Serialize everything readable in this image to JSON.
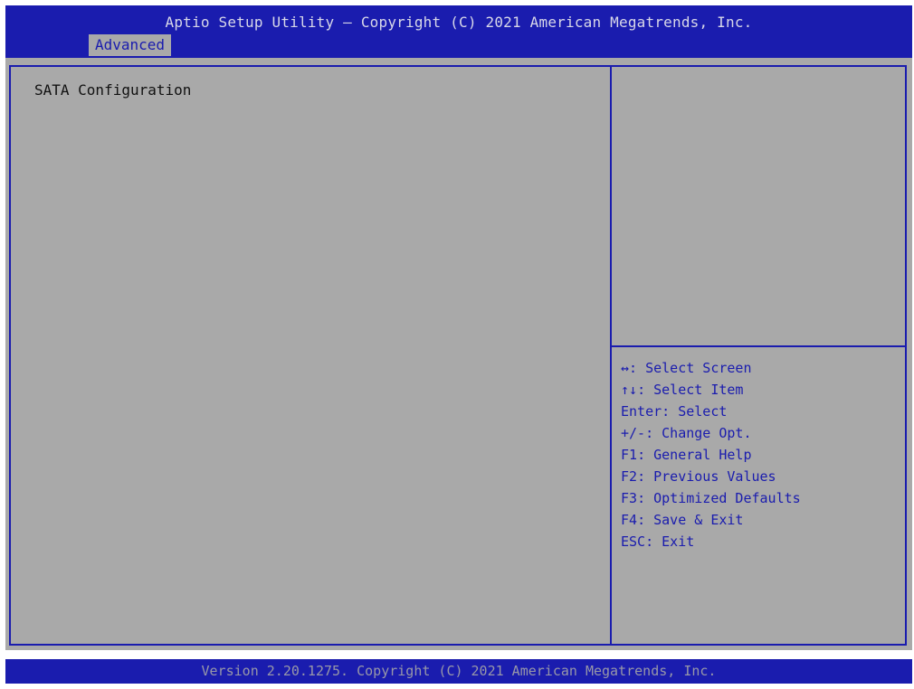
{
  "header": {
    "title": "Aptio Setup Utility – Copyright (C) 2021 American Megatrends, Inc.",
    "tabs": [
      {
        "label": "Advanced",
        "active": true
      }
    ]
  },
  "main": {
    "items": [
      {
        "label": "SATA Configuration"
      }
    ]
  },
  "help": {
    "keys": [
      {
        "key": "↔",
        "desc": ": Select Screen"
      },
      {
        "key": "↑↓",
        "desc": ": Select Item"
      },
      {
        "key": "Enter",
        "desc": ": Select"
      },
      {
        "key": "+/-",
        "desc": ": Change Opt."
      },
      {
        "key": "F1",
        "desc": ": General Help"
      },
      {
        "key": "F2",
        "desc": ": Previous Values"
      },
      {
        "key": "F3",
        "desc": ": Optimized Defaults"
      },
      {
        "key": "F4",
        "desc": ": Save & Exit"
      },
      {
        "key": "ESC",
        "desc": ": Exit"
      }
    ]
  },
  "footer": {
    "text": "Version 2.20.1275. Copyright (C) 2021 American Megatrends, Inc."
  },
  "colors": {
    "header_blue": "#1a1cae",
    "panel_gray": "#a9a9a9",
    "help_text": "#1a1cae",
    "item_text": "#111111"
  }
}
